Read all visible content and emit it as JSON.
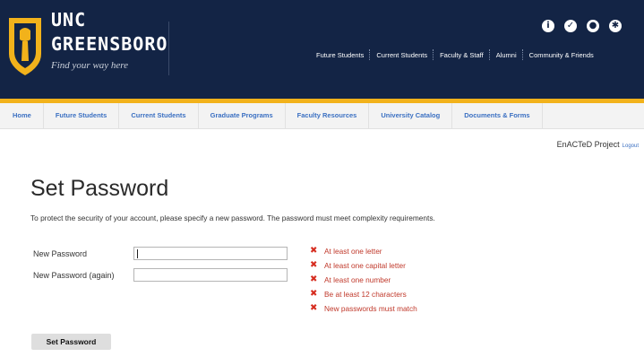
{
  "header": {
    "logo": {
      "line1": "UNC",
      "line2": "GREENSBORO",
      "tagline": "Find your way here"
    },
    "utility_icons": [
      "info-icon",
      "checkmark-icon",
      "person-icon",
      "gear-icon"
    ],
    "top_nav": [
      "Future Students",
      "Current Students",
      "Faculty & Staff",
      "Alumni",
      "Community & Friends"
    ],
    "colors": {
      "navy": "#132445",
      "gold": "#f2b21b",
      "link": "#3b70c2",
      "error": "#d62d20"
    }
  },
  "secondary_nav": [
    "Home",
    "Future Students",
    "Current Students",
    "Graduate Programs",
    "Faculty Resources",
    "University Catalog",
    "Documents & Forms"
  ],
  "account": {
    "name": "EnACTeD Project",
    "logout": "Logout"
  },
  "page": {
    "title": "Set Password",
    "description": "To protect the security of your account, please specify a new password. The password must meet complexity requirements."
  },
  "form": {
    "new_password_label": "New Password",
    "new_password_value": "",
    "confirm_password_label": "New Password (again)",
    "confirm_password_value": "",
    "submit_label": "Set Password"
  },
  "requirements": [
    "At least one letter",
    "At least one capital letter",
    "At least one number",
    "Be at least 12 characters",
    "New passwords must match"
  ]
}
